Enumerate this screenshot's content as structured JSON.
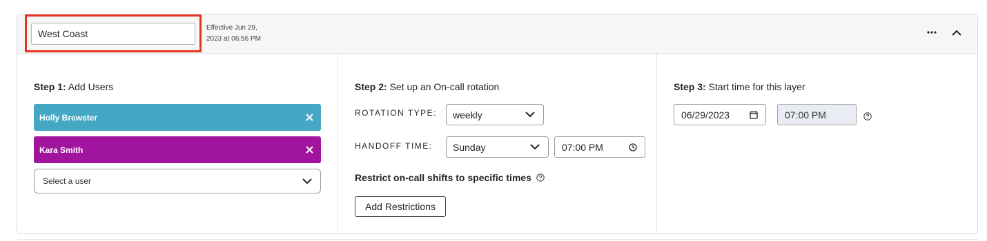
{
  "layer": {
    "name_value": "West Coast",
    "effective_line1": "Effective Jun 29,",
    "effective_line2": "2023 at 06:56 PM"
  },
  "step1": {
    "title_bold": "Step 1:",
    "title_rest": " Add Users",
    "users": [
      {
        "name": "Holly Brewster",
        "color": "#44a8c4"
      },
      {
        "name": "Kara Smith",
        "color": "#a0149e"
      }
    ],
    "select_placeholder": "Select a user"
  },
  "step2": {
    "title_bold": "Step 2:",
    "title_rest": " Set up an On-call rotation",
    "rotation_type_label": "ROTATION TYPE:",
    "rotation_type_value": "weekly",
    "handoff_time_label": "HANDOFF TIME:",
    "handoff_day_value": "Sunday",
    "handoff_time_value": "07:00 PM",
    "restrict_label": "Restrict on-call shifts to specific times",
    "add_restrictions_label": "Add Restrictions"
  },
  "step3": {
    "title_bold": "Step 3:",
    "title_rest": " Start time for this layer",
    "start_date_value": "06/29/2023",
    "start_time_value": "07:00 PM"
  },
  "icons": {
    "more": "more-horizontal-icon",
    "collapse": "chevron-up-icon",
    "remove": "close-icon",
    "dropdown": "chevron-down-icon",
    "calendar": "calendar-icon",
    "clock": "clock-icon",
    "help": "help-circle-icon"
  },
  "colors": {
    "highlight": "#e8321c",
    "disabled_field": "#e9ecf3"
  }
}
